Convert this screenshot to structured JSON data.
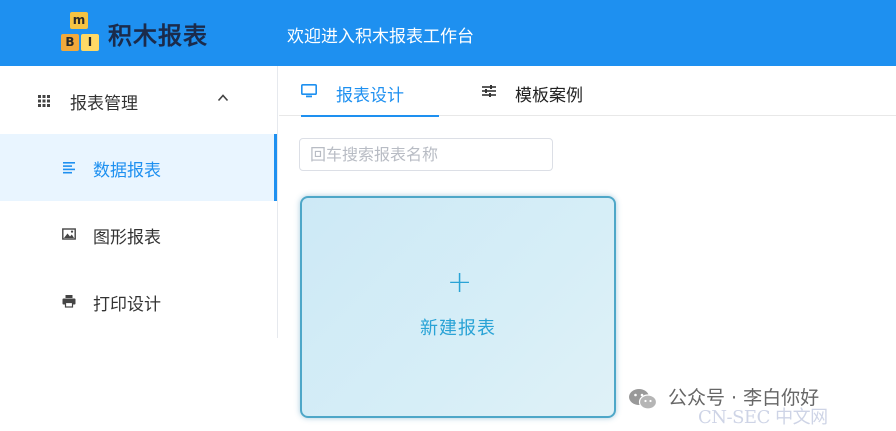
{
  "header": {
    "logo_letters": [
      "m",
      "B",
      "I"
    ],
    "logo_title": "积木报表",
    "welcome": "欢迎进入积木报表工作台",
    "bg_color": "#1e90f0"
  },
  "sidebar": {
    "group": {
      "label": "报表管理",
      "icon": "grid-icon",
      "expanded": true
    },
    "items": [
      {
        "label": "数据报表",
        "icon": "list-icon",
        "active": true
      },
      {
        "label": "图形报表",
        "icon": "image-icon",
        "active": false
      },
      {
        "label": "打印设计",
        "icon": "printer-icon",
        "active": false
      }
    ]
  },
  "tabs": [
    {
      "label": "报表设计",
      "icon": "monitor-icon",
      "active": true
    },
    {
      "label": "模板案例",
      "icon": "sliders-icon",
      "active": false
    }
  ],
  "search": {
    "placeholder": "回车搜索报表名称",
    "value": ""
  },
  "card": {
    "plus": "+",
    "label": "新建报表"
  },
  "watermark": {
    "text": "公众号 · 李白你好",
    "sub": "CN-SEC 中文网"
  },
  "colors": {
    "accent": "#1e90f0",
    "card_text": "#29a3d6",
    "active_bg": "#e9f5ff"
  }
}
